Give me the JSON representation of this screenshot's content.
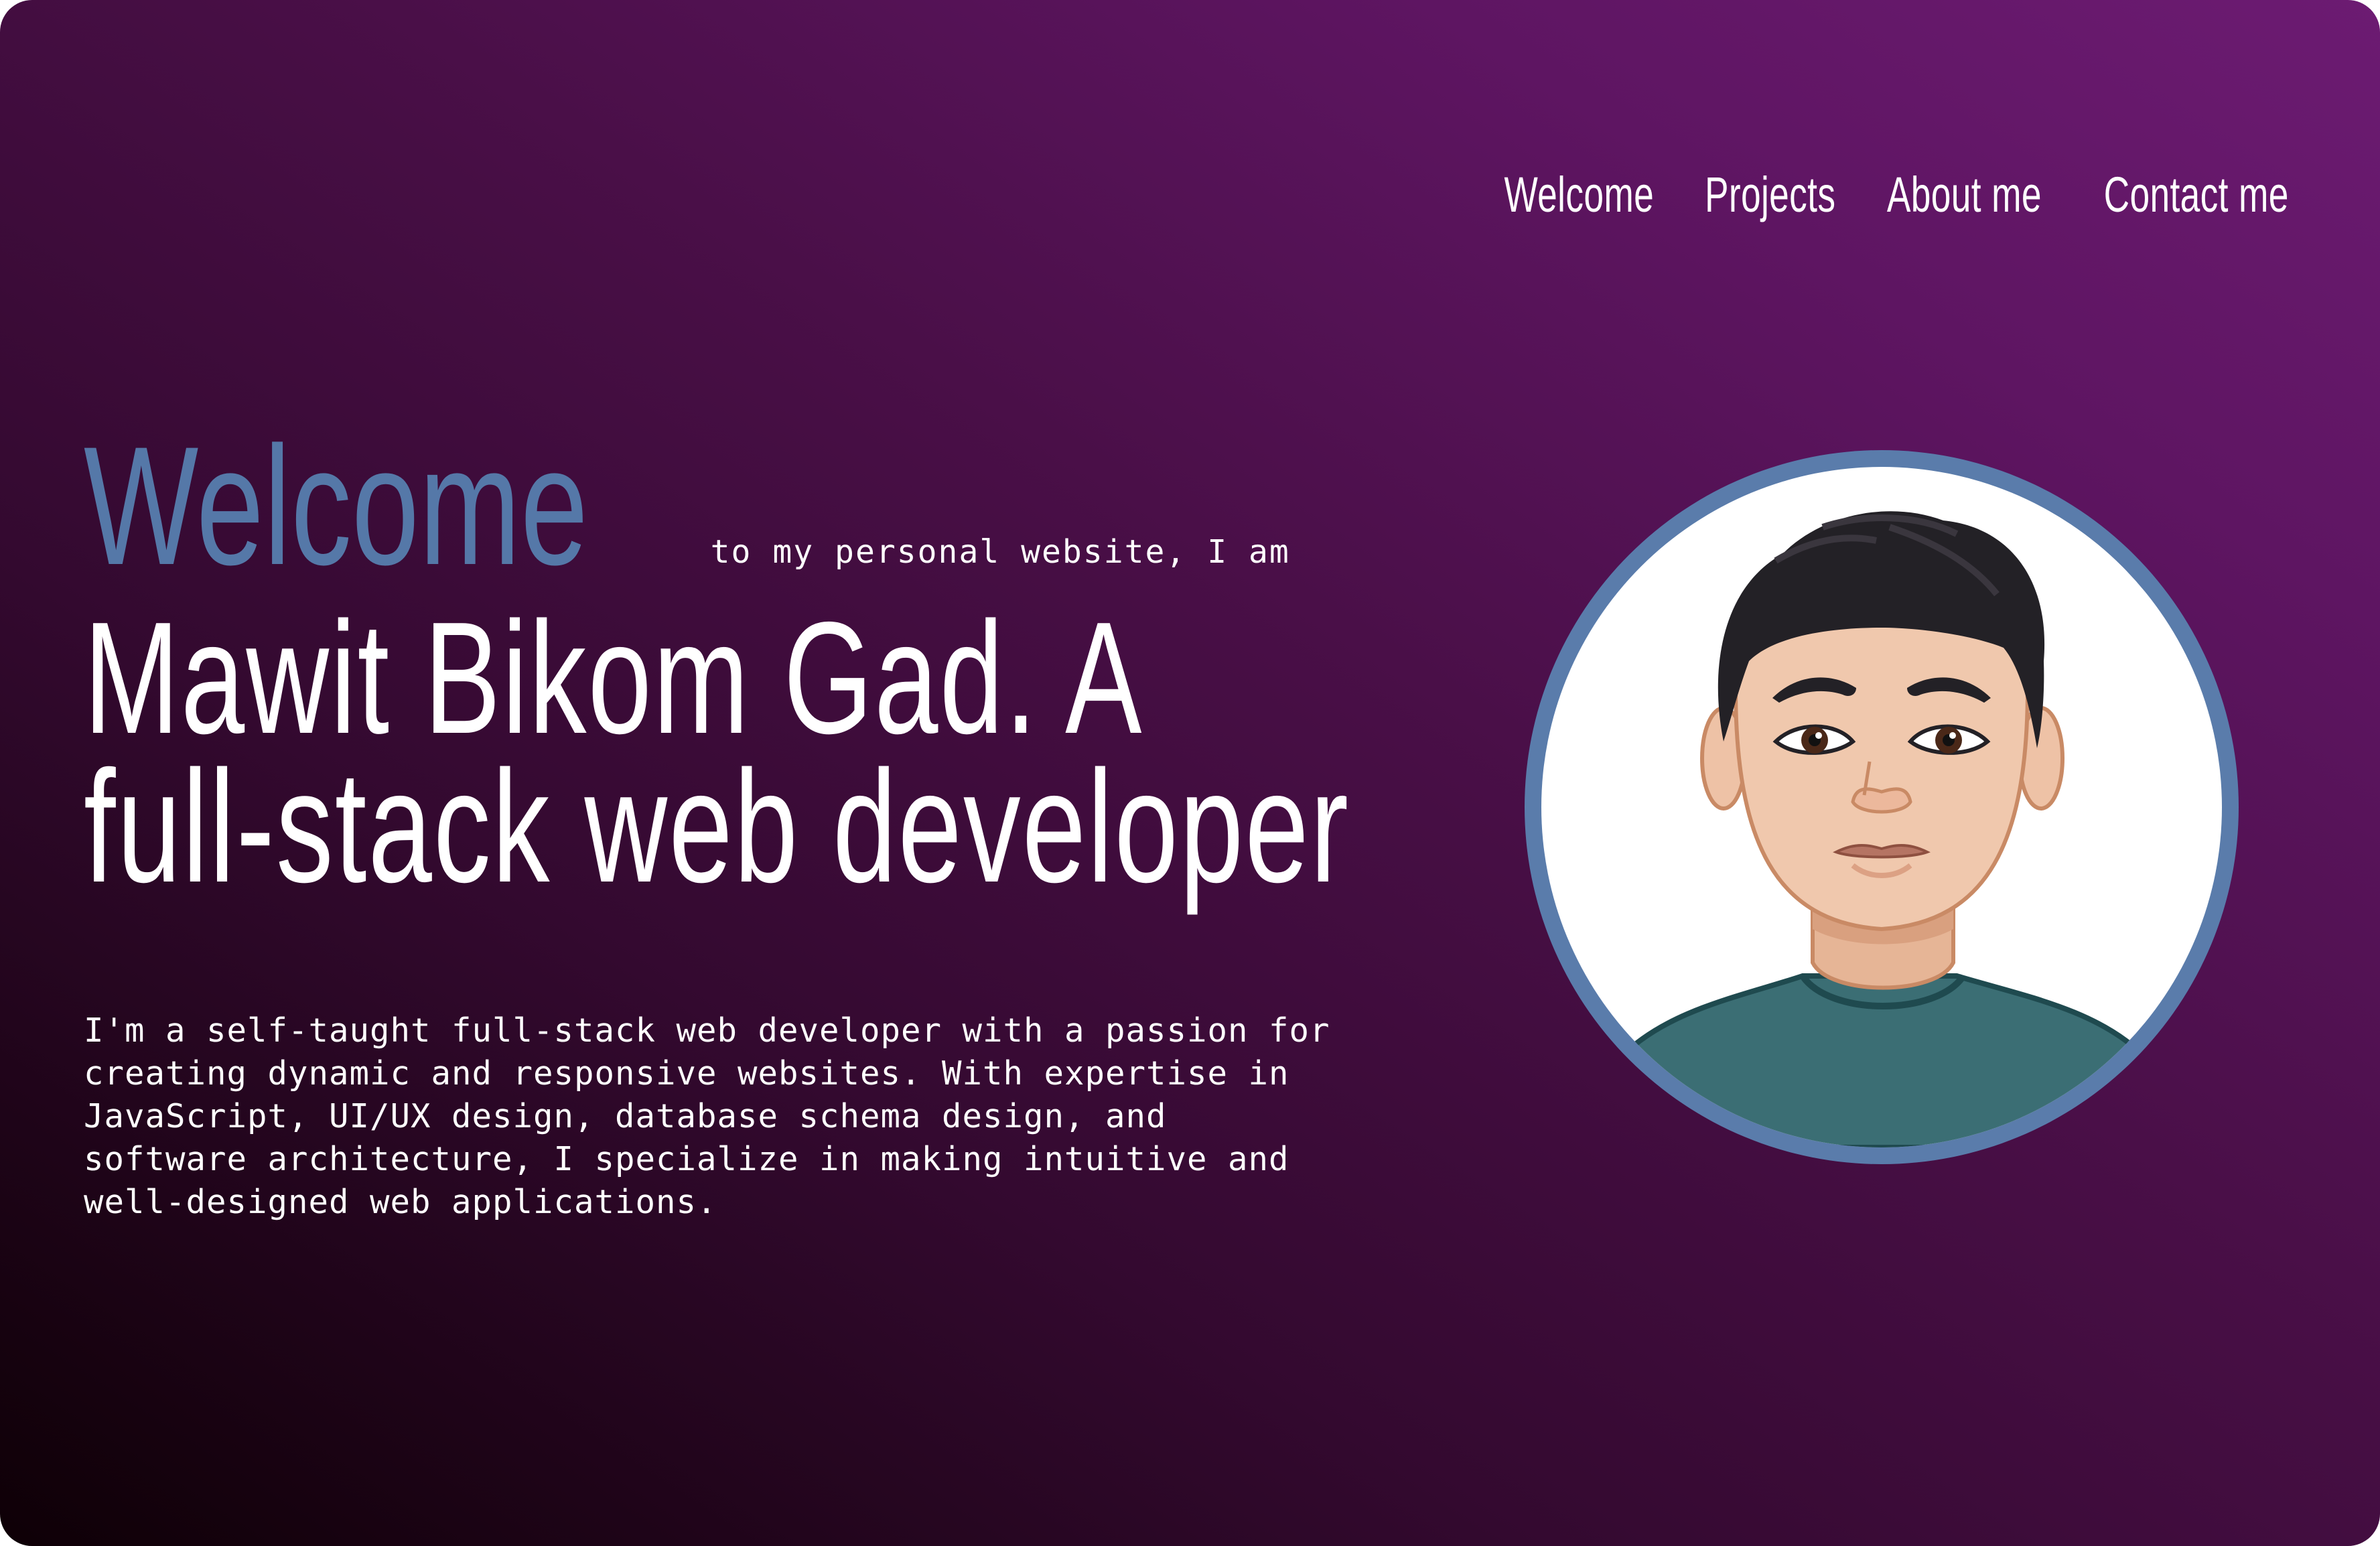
{
  "nav": {
    "items": [
      {
        "label": "Welcome"
      },
      {
        "label": "Projects"
      },
      {
        "label": "About me"
      },
      {
        "label": "Contact me"
      }
    ]
  },
  "hero": {
    "welcome_word": "Welcome",
    "welcome_rest": "to my personal website, I am",
    "headline": "Mawit Bikom Gad. A full-stack web developer",
    "intro": "I'm a self-taught full-stack web developer with a passion for creating dynamic and responsive websites. With expertise in JavaScript, UI/UX design, database schema design, and software architecture, I specialize in making intuitive and well-designed web applications."
  },
  "avatar": {
    "icon": "developer-avatar-illustration"
  },
  "colors": {
    "accent": "#5578a8",
    "background_start": "#0e0006",
    "background_end": "#6c1b72",
    "text": "#ffffff"
  }
}
